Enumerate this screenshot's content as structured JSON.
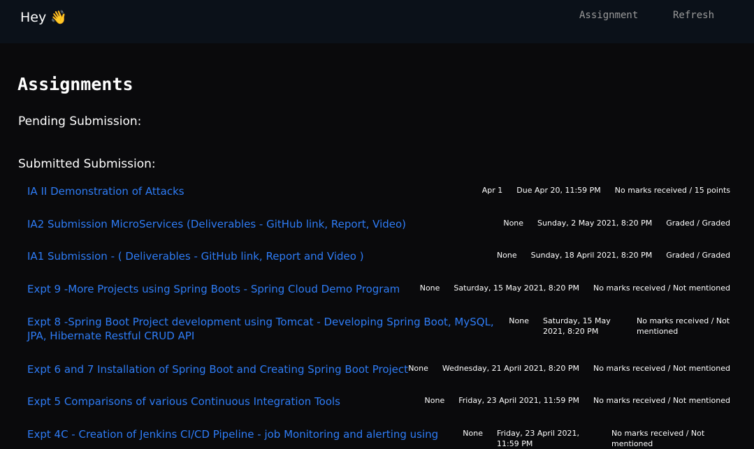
{
  "header": {
    "greeting": "Hey",
    "greeting_emoji": "👋",
    "nav": {
      "assignment": "Assignment",
      "refresh": "Refresh"
    }
  },
  "main": {
    "title": "Assignments",
    "pending_label": "Pending Submission:",
    "submitted_label": "Submitted Submission:",
    "assignments": [
      {
        "title": "IA II Demonstration of Attacks",
        "posted": "Apr 1",
        "due": "Due Apr 20, 11:59 PM",
        "status": "No marks received / 15 points"
      },
      {
        "title": "IA2 Submission MicroServices (Deliverables - GitHub link, Report, Video)",
        "posted": "None",
        "due": "Sunday, 2 May 2021, 8:20 PM",
        "status": "Graded / Graded"
      },
      {
        "title": "IA1 Submission - ( Deliverables - GitHub link, Report and Video )",
        "posted": "None",
        "due": "Sunday, 18 April 2021, 8:20 PM",
        "status": "Graded / Graded"
      },
      {
        "title": "Expt 9 -More Projects using Spring Boots - Spring Cloud Demo Program",
        "posted": "None",
        "due": "Saturday, 15 May 2021, 8:20 PM",
        "status": "No marks received / Not mentioned"
      },
      {
        "title": "Expt 8 -Spring Boot Project development using Tomcat - Developing Spring Boot, MySQL, JPA, Hibernate Restful CRUD API",
        "posted": "None",
        "due": "Saturday, 15 May 2021, 8:20 PM",
        "status": "No marks received / Not mentioned"
      },
      {
        "title": "Expt 6 and 7 Installation of Spring Boot and Creating Spring Boot Project",
        "posted": "None",
        "due": "Wednesday, 21 April 2021, 8:20 PM",
        "status": "No marks received / Not mentioned"
      },
      {
        "title": "Expt 5 Comparisons of various Continuous Integration Tools",
        "posted": "None",
        "due": "Friday, 23 April 2021, 11:59 PM",
        "status": "No marks received / Not mentioned"
      },
      {
        "title": "Expt 4C - Creation of Jenkins CI/CD Pipeline - job Monitoring and alerting using",
        "posted": "None",
        "due": "Friday, 23 April 2021, 11:59 PM",
        "status": "No marks received / Not mentioned"
      }
    ]
  },
  "colors": {
    "background": "#0a0a0c",
    "navbar": "#0b1119",
    "link": "#2e7cf6",
    "nav_text": "#9a9a9a"
  }
}
